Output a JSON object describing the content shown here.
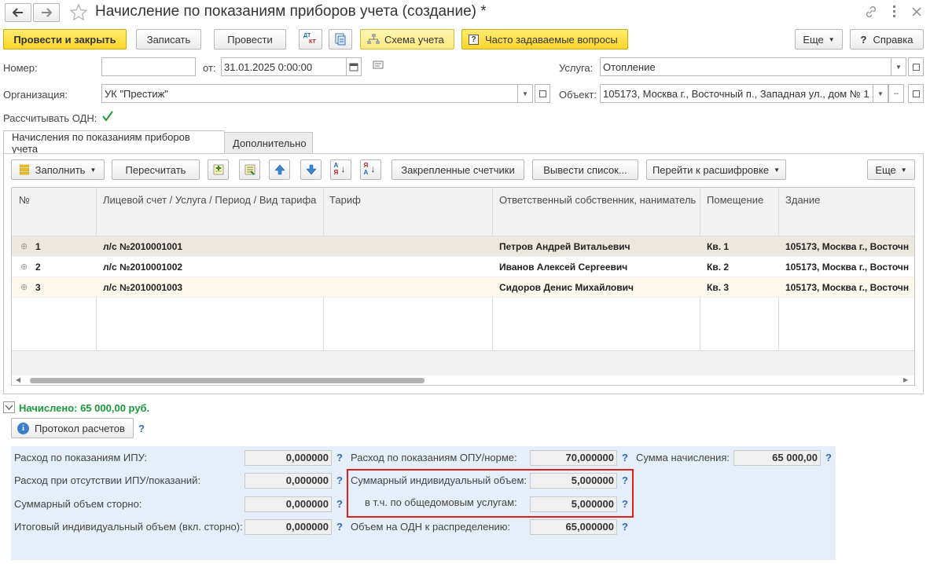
{
  "window": {
    "title": "Начисление по показаниям приборов учета (создание) *"
  },
  "toolbar": {
    "post_close": "Провести и закрыть",
    "save": "Записать",
    "post": "Провести",
    "dt_icon_text_top": "ДТ",
    "dt_icon_text_bottom": "КТ",
    "scheme": "Схема учета",
    "faq": "Часто задаваемые вопросы",
    "more": "Еще",
    "help": "Справка"
  },
  "form": {
    "number_label": "Номер:",
    "number_value": "",
    "from_label": "от:",
    "date_value": "31.01.2025  0:00:00",
    "org_label": "Организация:",
    "org_value": "УК \"Престиж\"",
    "odn_label": "Рассчитывать ОДН:",
    "service_label": "Услуга:",
    "service_value": "Отопление",
    "object_label": "Объект:",
    "object_value": "105173, Москва г., Восточный п., Западная ул., дом № 1"
  },
  "tabs": [
    {
      "label": "Начисления по показаниям приборов учета"
    },
    {
      "label": "Дополнительно"
    }
  ],
  "tab_toolbar": {
    "fill": "Заполнить",
    "recalc": "Пересчитать",
    "az_top": "А",
    "az_bottom": "Я",
    "za_top": "Я",
    "za_bottom": "А",
    "pinned": "Закрепленные счетчики",
    "output_list": "Вывести список...",
    "go_decode": "Перейти к расшифровке",
    "more": "Еще"
  },
  "table": {
    "columns": [
      "№",
      "Лицевой счет / Услуга / Период / Вид тарифа",
      "Тариф",
      "Ответственный собственник, наниматель",
      "Помещение",
      "Здание"
    ],
    "rows": [
      {
        "num": "1",
        "account": "л/с №2010001001",
        "tariff": "",
        "owner": "Петров Андрей Витальевич",
        "room": "Кв. 1",
        "building": "105173, Москва г., Восточн"
      },
      {
        "num": "2",
        "account": "л/с №2010001002",
        "tariff": "",
        "owner": "Иванов Алексей Сергеевич",
        "room": "Кв. 2",
        "building": "105173, Москва г., Восточн"
      },
      {
        "num": "3",
        "account": "л/с №2010001003",
        "tariff": "",
        "owner": "Сидоров Денис Михайлович",
        "room": "Кв. 3",
        "building": "105173, Москва г., Восточн"
      }
    ]
  },
  "summary": {
    "accrued": "Начислено: 65 000,00 руб.",
    "protocol": "Протокол расчетов",
    "q": "?"
  },
  "panel": {
    "col1": [
      {
        "label": "Расход по показаниям ИПУ:",
        "value": "0,000000"
      },
      {
        "label": "Расход при отсутствии ИПУ/показаний:",
        "value": "0,000000"
      },
      {
        "label": "Суммарный объем сторно:",
        "value": "0,000000"
      },
      {
        "label": "Итоговый индивидуальный объем (вкл. сторно):",
        "value": "0,000000"
      }
    ],
    "col2": [
      {
        "label": "Расход по показаниям ОПУ/норме:",
        "value": "70,000000"
      },
      {
        "label": "Суммарный индивидуальный объем:",
        "value": "5,000000"
      },
      {
        "label": "в т.ч. по общедомовым услугам:",
        "value": "5,000000"
      },
      {
        "label": "Объем на ОДН к распределению:",
        "value": "65,000000"
      }
    ],
    "col3": [
      {
        "label": "Сумма начисления:",
        "value": "65 000,00"
      }
    ]
  },
  "colors": {
    "accent_yellow": "#ffd62a",
    "highlight_red": "#e0201e",
    "accrued_green": "#1a9a3a",
    "panel_bg": "#e6eefa"
  }
}
